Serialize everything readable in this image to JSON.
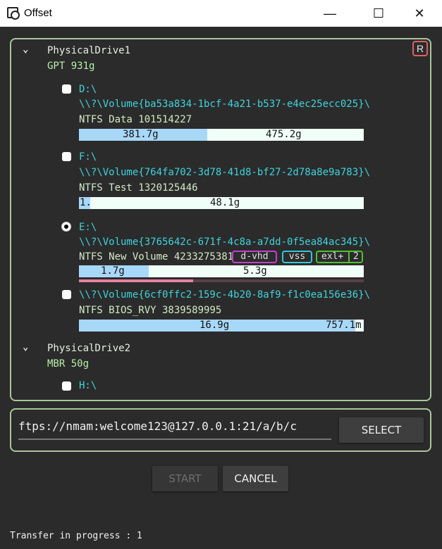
{
  "window": {
    "title": "Offset",
    "minimize": "—",
    "maximize": "☐",
    "close": "✕"
  },
  "refresh_label": "R",
  "drives": [
    {
      "name": "PhysicalDrive1",
      "info": "GPT 931g",
      "volumes": [
        {
          "letter": "D:\\",
          "guid": "\\\\?\\Volume{ba53a834-1bcf-4a21-b537-e4ec25ecc025}\\",
          "info": "NTFS Data 101514227",
          "used": "381.7g",
          "free": "475.2g",
          "used_pct": 45,
          "selected": false
        },
        {
          "letter": "F:\\",
          "guid": "\\\\?\\Volume{764fa702-3d78-41d8-bf27-2d78a8e9a783}\\",
          "info": "NTFS Test 1320125446",
          "used": "1.",
          "free": "48.1g",
          "used_pct": 4,
          "selected": false
        },
        {
          "letter": "E:\\",
          "guid": "\\\\?\\Volume{3765642c-671f-4c8a-a7dd-0f5ea84ac345}\\",
          "info": "NTFS New Volume 4233275381",
          "used": "1.7g",
          "free": "5.3g",
          "used_pct": 24.5,
          "progress_pct": 40,
          "selected": true,
          "tags": [
            {
              "label": "d-vhd",
              "color": "#c040d0"
            },
            {
              "label": "vss",
              "color": "#30c8d8"
            },
            {
              "label": "exl+",
              "count": "2",
              "color": "#50c030"
            }
          ]
        },
        {
          "letter": "",
          "guid": "\\\\?\\Volume{6cf0ffc2-159c-4b20-8af9-f1c0ea156e36}\\",
          "info": "NTFS BIOS_RVY 3839589995",
          "used": "16.9g",
          "free": "757.1m",
          "used_pct": 97,
          "selected": false
        }
      ]
    },
    {
      "name": "PhysicalDrive2",
      "info": "MBR 50g",
      "volumes": [
        {
          "letter": "H:\\",
          "selected": false
        }
      ]
    }
  ],
  "destination": {
    "value": "ftps://nmam:welcome123@127.0.0.1:21/a/b/c",
    "select_label": "SELECT"
  },
  "actions": {
    "start": "START",
    "cancel": "CANCEL"
  },
  "status": "Transfer in progress : 1",
  "colors": {
    "border": "#a9c69c",
    "used": "#a8d8f8",
    "free": "#f0fff8",
    "progress": "#e77fa0",
    "progress_track": "#5a4048"
  }
}
